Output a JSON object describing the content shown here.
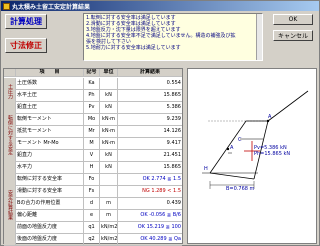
{
  "window": {
    "title": "丸太積み土留工安定計算結果"
  },
  "buttons": {
    "calc": "計算処理",
    "fix": "寸法修正",
    "ok": "OK",
    "cancel": "キャンセル"
  },
  "messages": [
    "1.転倒に対する安全率は満足しています",
    "2.滑動に対する安全率は満足しています",
    "3.地盤反力・沈下量は限界を超えています",
    "4.地盤に対する安全率不足で満足していません。構造の補強及び拡",
    "張を検討して下さい",
    "5.地耐力に対する安全率は満足しています"
  ],
  "table": {
    "headers": {
      "name": "項　　目",
      "sym": "記号",
      "unit": "単位",
      "val": "計算結果"
    },
    "groups": [
      "土圧力",
      "転倒に対する安定",
      "安定計算結果"
    ],
    "rows": [
      {
        "name": "土圧係数",
        "sym": "Ka",
        "unit": "",
        "val": "0.554",
        "status": ""
      },
      {
        "name": "水平土圧",
        "sym": "Ph",
        "unit": "kN",
        "val": "15.865",
        "status": ""
      },
      {
        "name": "鉛直土圧",
        "sym": "Pv",
        "unit": "kN",
        "val": "5.386",
        "status": ""
      },
      {
        "name": "転倒モーメント",
        "sym": "Mo",
        "unit": "kN·m",
        "val": "9.239",
        "status": ""
      },
      {
        "name": "抵抗モーメント",
        "sym": "Mr",
        "unit": "kN·m",
        "val": "14.126",
        "status": ""
      },
      {
        "name": "モーメント  Mr-Mo",
        "sym": "M",
        "unit": "kN·m",
        "val": "9.417",
        "status": ""
      },
      {
        "name": "鉛直力",
        "sym": "V",
        "unit": "kN",
        "val": "21.451",
        "status": ""
      },
      {
        "name": "水平力",
        "sym": "H",
        "unit": "kN",
        "val": "15.865",
        "status": ""
      },
      {
        "name": "転倒に対する安全率",
        "sym": "Fo",
        "unit": "",
        "val": "OK  2.774 ≧ 1.5",
        "status": "ok"
      },
      {
        "name": "滑動に対する安全率",
        "sym": "Fs",
        "unit": "",
        "val": "NG  1.289 < 1.5",
        "status": "ng"
      },
      {
        "name": "Bの合力の作用位置",
        "sym": "d",
        "unit": "m",
        "val": "0.439",
        "status": ""
      },
      {
        "name": "偏心距離",
        "sym": "e",
        "unit": "m",
        "val": "OK  -0.056 ≦ B/6",
        "status": "ok"
      },
      {
        "name": "前面の地盤反力度",
        "sym": "q1",
        "unit": "kN/m2",
        "val": "OK  15.219 ≦ 100",
        "status": "ok"
      },
      {
        "name": "後面の地盤反力度",
        "sym": "q2",
        "unit": "kN/m2",
        "val": "OK  40.289 ≦ Qa",
        "status": "ok"
      }
    ]
  },
  "diagram": {
    "labels": {
      "pv": "Pv=5.386 kN",
      "ph": "Ph=15.865 kN",
      "b": "B=0.768 m",
      "a": "A",
      "a2": "A",
      "c": "C",
      "h": "H"
    }
  }
}
